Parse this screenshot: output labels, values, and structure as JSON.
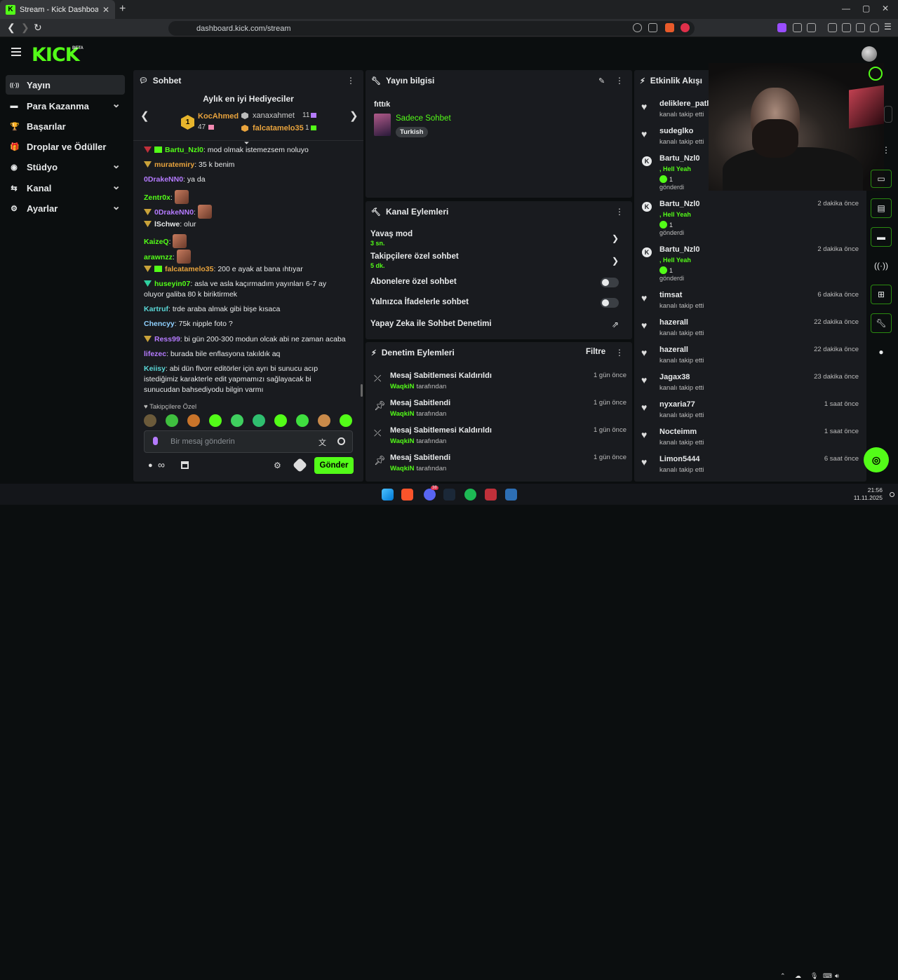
{
  "browser": {
    "tab_title": "Stream - Kick Dashboard",
    "url": "dashboard.kick.com/stream",
    "notification_count": "1",
    "new_tab": "+",
    "tab_close": "✕"
  },
  "header": {
    "logo": "KICK",
    "beta": "BETA"
  },
  "sidebar": {
    "items": [
      {
        "label": "Yayın",
        "icon": "broadcast-icon",
        "glyph": "((·))",
        "expandable": false,
        "active": true
      },
      {
        "label": "Para Kazanma",
        "icon": "money-icon",
        "glyph": "▬",
        "expandable": true
      },
      {
        "label": "Başarılar",
        "icon": "trophy-icon",
        "glyph": "🏆",
        "expandable": false
      },
      {
        "label": "Droplar ve Ödüller",
        "icon": "gift-icon",
        "glyph": "🎁",
        "expandable": false
      },
      {
        "label": "Stüdyo",
        "icon": "studio-icon",
        "glyph": "◉",
        "expandable": true
      },
      {
        "label": "Kanal",
        "icon": "channel-icon",
        "glyph": "⇆",
        "expandable": true
      },
      {
        "label": "Ayarlar",
        "icon": "gear-icon",
        "glyph": "⚙",
        "expandable": true
      }
    ]
  },
  "chat": {
    "title": "Sohbet",
    "gifters_title": "Aylık en iyi Hediyeciler",
    "top_gifter": {
      "rank": "1",
      "name": "KocAhmed",
      "count": "47"
    },
    "gifter_2": {
      "name": "xanaxahmet",
      "count": "11"
    },
    "gifter_3": {
      "name": "falcatamelo35",
      "count": "1"
    },
    "messages": [
      {
        "user": "Bartu_Nzl0",
        "color": "#53fc18",
        "text": "mod olmak istemezsem noluyo"
      },
      {
        "user": "muratemiry",
        "color": "#e8a33d",
        "text": "35 k benim"
      },
      {
        "user": "0DrakeNN0",
        "color": "#b57bff",
        "text": "ya da"
      },
      {
        "user": "Zentr0x",
        "color": "#53fc18",
        "text": ""
      },
      {
        "user": "0DrakeNN0",
        "color": "#b57bff",
        "text": ""
      },
      {
        "user": "lSchwe",
        "color": "#e8eaeb",
        "text": "olur"
      },
      {
        "user": "KaizeQ",
        "color": "#53fc18",
        "text": ""
      },
      {
        "user": "arawnzz",
        "color": "#53fc18",
        "text": ""
      },
      {
        "user": "falcatamelo35",
        "color": "#e8a33d",
        "text": "200 e ayak at bana ıhtıyar"
      },
      {
        "user": "huseyin07",
        "color": "#53fc18",
        "text": "asla ve asla kaçırmadım yayınları 6-7 ay oluyor galiba 80 k biriktirmek"
      },
      {
        "user": "Kartruf",
        "color": "#5ad6d6",
        "text": "trde araba almak gibi bişe kısaca"
      },
      {
        "user": "Chencyy",
        "color": "#8fd0ff",
        "text": "75k nipple foto ?"
      },
      {
        "user": "Ress99",
        "color": "#b57bff",
        "text": "bi gün 200-300 modun olcak abi ne zaman acaba"
      },
      {
        "user": "lifezec",
        "color": "#b57bff",
        "text": "burada bile enflasyona takıldık aq"
      },
      {
        "user": "Keiisy",
        "color": "#5ad6d6",
        "text": "abi dün flvorr editörler için ayrı bi sunucu acıp istediğimiz karakterle edit yapmamızı sağlayacak bi sunucudan bahsediyodu bilgin varmı"
      }
    ],
    "followers_only_label": "Takipçilere Özel",
    "input_placeholder": "Bir mesaj gönderin",
    "send_label": "Gönder",
    "infinity": "∞"
  },
  "stream_info": {
    "title": "Yayın bilgisi",
    "stream_title": "fıttık",
    "category": "Sadece Sohbet",
    "tag": "Turkish"
  },
  "channel_actions": {
    "title": "Kanal Eylemleri",
    "items": [
      {
        "label": "Yavaş mod",
        "sub": "3 sn.",
        "control": "chevron"
      },
      {
        "label": "Takipçilere özel sohbet",
        "sub": "5 dk.",
        "control": "chevron"
      },
      {
        "label": "Abonelere özel sohbet",
        "sub": "",
        "control": "toggle",
        "on": false
      },
      {
        "label": "Yalnızca İfadelerle sohbet",
        "sub": "",
        "control": "toggle",
        "on": false
      },
      {
        "label": "Yapay Zeka ile Sohbet Denetimi",
        "sub": "",
        "control": "external"
      }
    ]
  },
  "mod_actions": {
    "title": "Denetim Eylemleri",
    "filter_label": "Filtre",
    "by_suffix": "tarafından",
    "items": [
      {
        "action": "Mesaj Sabitlemesi Kaldırıldı",
        "by": "WaqkiN",
        "time": "1 gün önce",
        "icon": "unpin-icon"
      },
      {
        "action": "Mesaj Sabitlendi",
        "by": "WaqkiN",
        "time": "1 gün önce",
        "icon": "pin-icon"
      },
      {
        "action": "Mesaj Sabitlemesi Kaldırıldı",
        "by": "WaqkiN",
        "time": "1 gün önce",
        "icon": "unpin-icon"
      },
      {
        "action": "Mesaj Sabitlendi",
        "by": "WaqkiN",
        "time": "1 gün önce",
        "icon": "pin-icon"
      }
    ]
  },
  "activity": {
    "title": "Etkinlik Akışı",
    "follow_text": "kanalı takip etti",
    "gift_line": ", Hell Yeah",
    "gift_count": "1",
    "gift_sent": "gönderdi",
    "events": [
      {
        "type": "follow",
        "user": "deliklere_patla",
        "time": ""
      },
      {
        "type": "follow",
        "user": "sudeglko",
        "time": ""
      },
      {
        "type": "gift",
        "user": "Bartu_Nzl0",
        "time": ""
      },
      {
        "type": "gift",
        "user": "Bartu_Nzl0",
        "time": "2 dakika önce"
      },
      {
        "type": "gift",
        "user": "Bartu_Nzl0",
        "time": "2 dakika önce"
      },
      {
        "type": "follow",
        "user": "timsat",
        "time": "6 dakika önce"
      },
      {
        "type": "follow",
        "user": "hazerall",
        "time": "22 dakika önce"
      },
      {
        "type": "follow",
        "user": "hazerall",
        "time": "22 dakika önce"
      },
      {
        "type": "follow",
        "user": "Jagax38",
        "time": "23 dakika önce"
      },
      {
        "type": "follow",
        "user": "nyxaria77",
        "time": "1 saat önce"
      },
      {
        "type": "follow",
        "user": "Nocteimm",
        "time": "1 saat önce"
      },
      {
        "type": "follow",
        "user": "Limon5444",
        "time": "6 saat önce"
      }
    ]
  },
  "taskbar": {
    "time": "21:56",
    "date": "11.11.2025",
    "discord_badge": "38"
  },
  "colors": {
    "accent": "#53fc18",
    "panel": "#191b1f",
    "bg": "#0b0e0f"
  }
}
